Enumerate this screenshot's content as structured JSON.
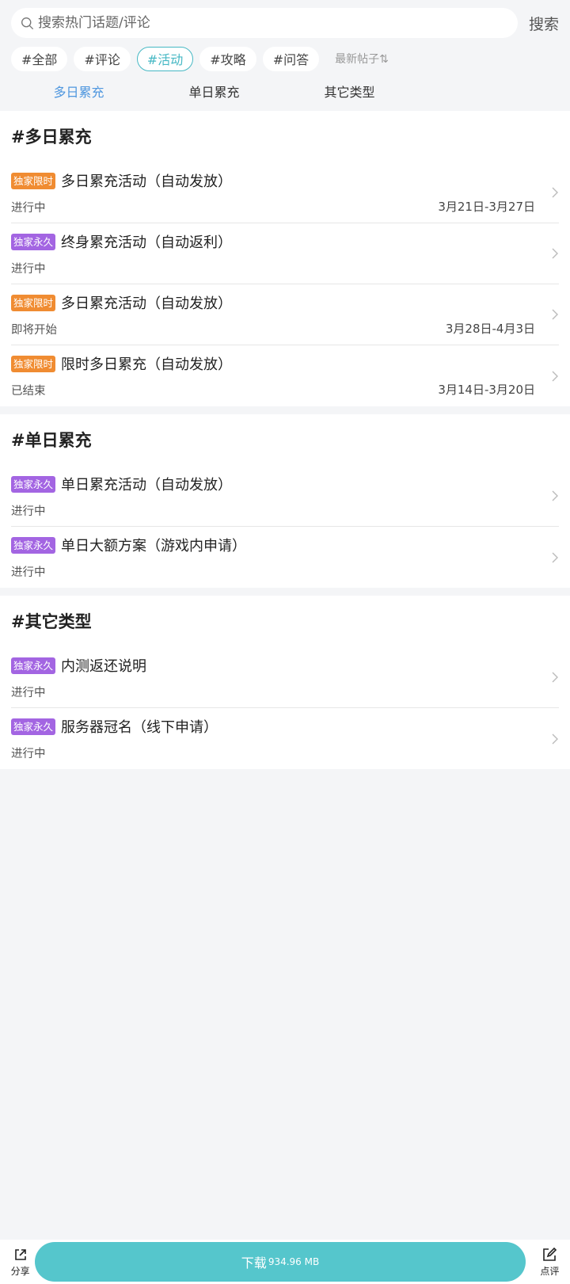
{
  "search": {
    "placeholder": "搜索热门话题/评论",
    "button": "搜索"
  },
  "chips": [
    "#全部",
    "#评论",
    "#活动",
    "#攻略",
    "#问答"
  ],
  "sort_label": "最新帖子⇅",
  "tabs": [
    "多日累充",
    "单日累充",
    "其它类型"
  ],
  "sections": [
    {
      "title": "#多日累充",
      "items": [
        {
          "badge": "独家限时",
          "title": "多日累充活动（自动发放）",
          "status": "进行中",
          "date": "3月21日-3月27日"
        },
        {
          "badge": "独家永久",
          "title": "终身累充活动（自动返利）",
          "status": "进行中",
          "date": ""
        },
        {
          "badge": "独家限时",
          "title": "多日累充活动（自动发放）",
          "status": "即将开始",
          "date": "3月28日-4月3日"
        },
        {
          "badge": "独家限时",
          "title": "限时多日累充（自动发放）",
          "status": "已结束",
          "date": "3月14日-3月20日"
        }
      ]
    },
    {
      "title": "#单日累充",
      "items": [
        {
          "badge": "独家永久",
          "title": "单日累充活动（自动发放）",
          "status": "进行中",
          "date": ""
        },
        {
          "badge": "独家永久",
          "title": "单日大额方案（游戏内申请）",
          "status": "进行中",
          "date": ""
        }
      ]
    },
    {
      "title": "#其它类型",
      "items": [
        {
          "badge": "独家永久",
          "title": "内测返还说明",
          "status": "进行中",
          "date": ""
        },
        {
          "badge": "独家永久",
          "title": "服务器冠名（线下申请）",
          "status": "进行中",
          "date": ""
        }
      ]
    }
  ],
  "bottom": {
    "share": "分享",
    "download": "下载",
    "size": "934.96 MB",
    "review": "点评"
  },
  "colors": {
    "accent": "#55c6cc",
    "active_chip": "#46b8c4",
    "active_tab": "#4f97df",
    "badge_limited": "#f08c32",
    "badge_permanent": "#a365e2"
  },
  "icons": [
    "search-icon",
    "sort-icon",
    "chevron-right-icon",
    "share-icon",
    "edit-icon"
  ]
}
